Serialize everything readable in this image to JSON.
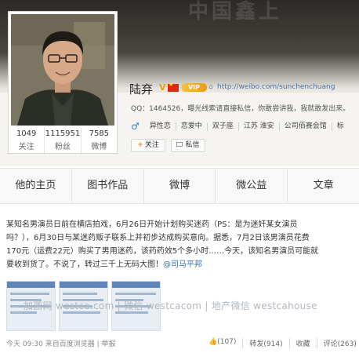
{
  "banner": {
    "title_text": "中国鑫上"
  },
  "profile": {
    "name": "陆弃",
    "verified_mark": "V",
    "vip_label": "VIP",
    "url": "http://weibo.com/sunchenchuang",
    "intro": "QQ：1464526，曝光线索请直接私信，你敢尝讲我，我就敢发出来。",
    "gender_symbol": "♂",
    "tags": [
      "异性恋",
      "恋爱中",
      "双子座",
      "江苏 淮安",
      "公司佰赛会馆",
      "标"
    ],
    "follow_label": "关注",
    "message_label": "私信"
  },
  "stats": [
    {
      "value": "1049",
      "label": "关注"
    },
    {
      "value": "1115951",
      "label": "粉丝"
    },
    {
      "value": "7585",
      "label": "微博"
    }
  ],
  "tabs": [
    "他的主页",
    "图书作品",
    "微博",
    "微公益",
    "文章"
  ],
  "post": {
    "line1": "某知名男演员日前在横店拍戏，6月26日开始计划购买迷药（PS：是为迷奸某女演员",
    "line2": "吗？），6月30日与某迷药贩子联系上并初步达成购买意向。据悉，7月2日该男演员花费",
    "line3": "170元（运费22元）购买了男用迷药，该药药效5个多小时……今天，该知名男演员可能就",
    "line4_text": "要收到货了。不说了，转过三千上无码大图！",
    "mention": "@司马平邦",
    "watermark": "加西网 westca.com | 微信 westcacom | 地产微信 westcahouse",
    "time": "今天 09:30",
    "source": "来自百度浏览器",
    "report": "举报",
    "likes": "(107)",
    "repost": "转发(914)",
    "favorite": "收藏",
    "comment": "评论(263)"
  },
  "colors": {
    "link": "#3b6ea8",
    "accent_orange": "#f29100"
  }
}
